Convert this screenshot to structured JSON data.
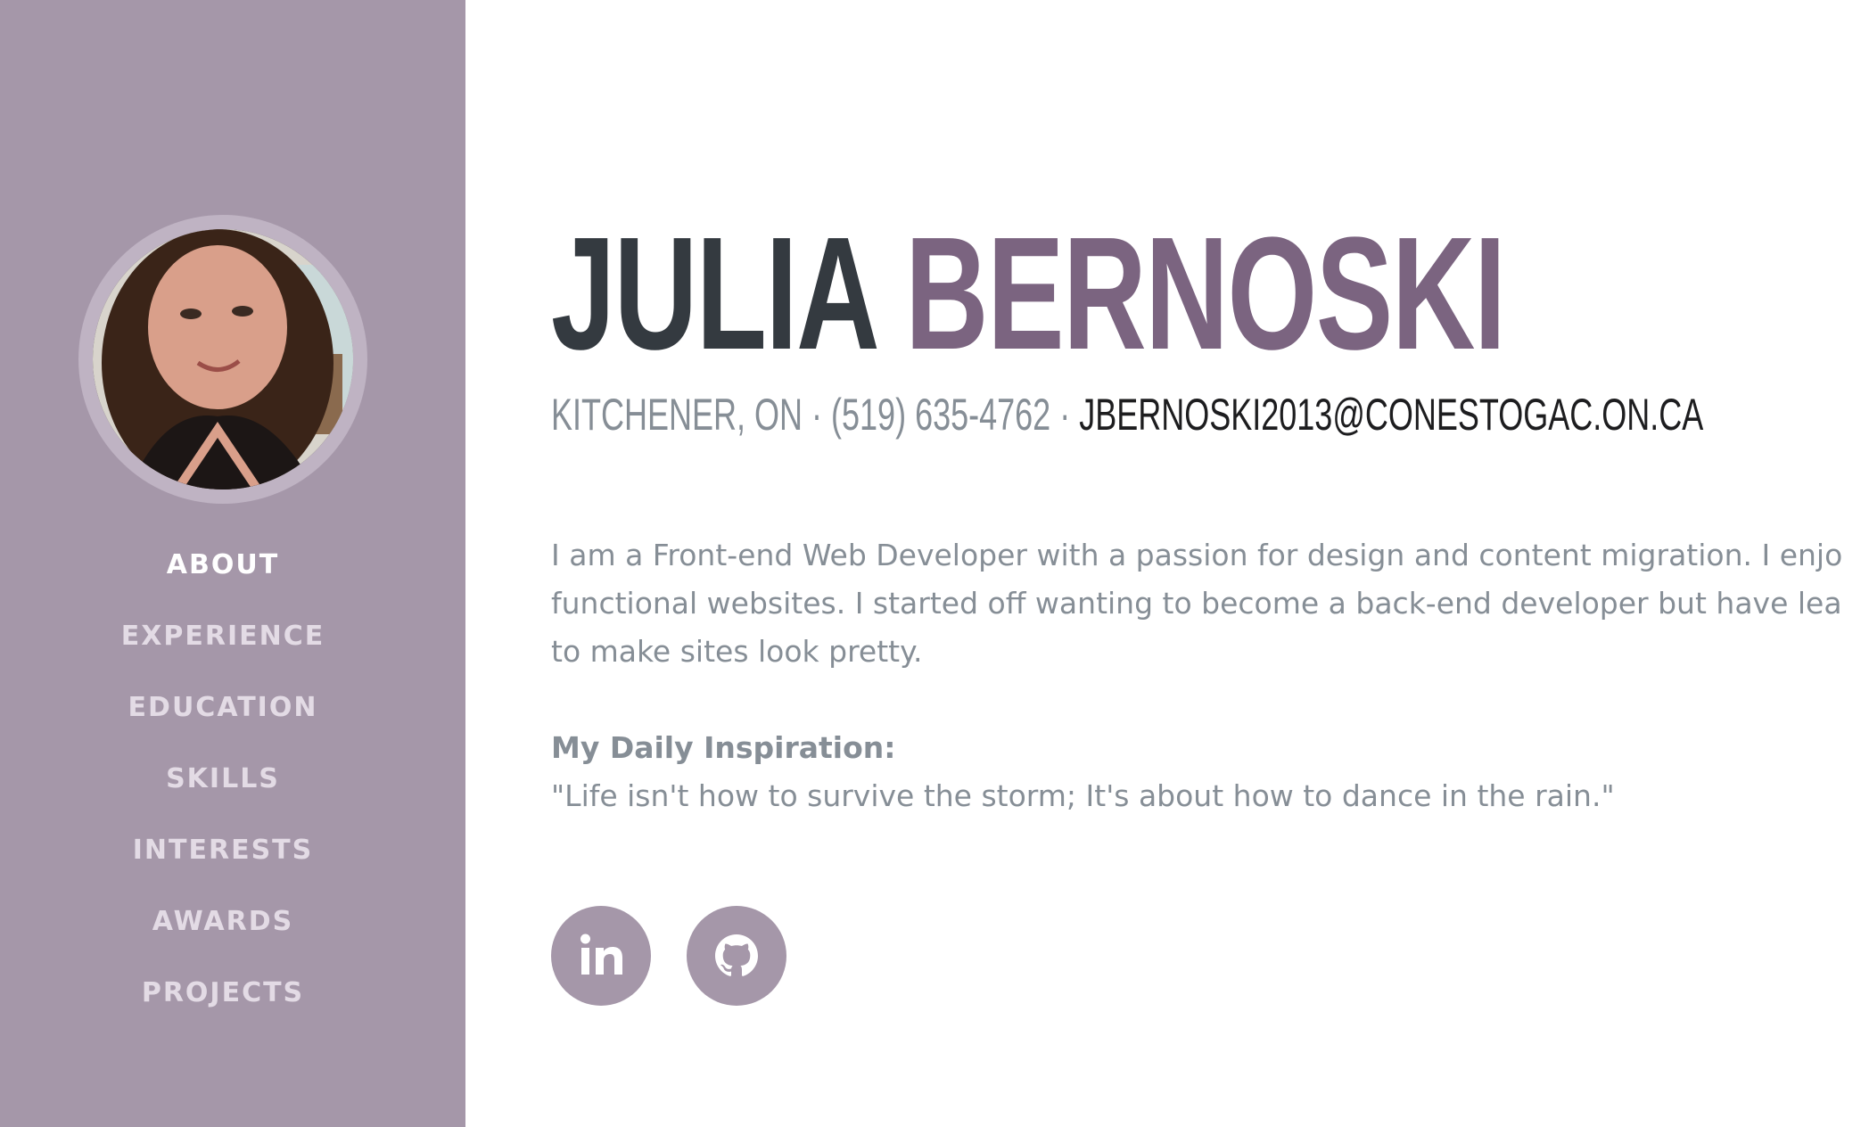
{
  "colors": {
    "sidebar": "#a597a9",
    "accent": "#7b6480",
    "name_dark": "#343a40",
    "muted_text": "#868e96"
  },
  "sidebar": {
    "nav": [
      {
        "label": "ABOUT",
        "active": true
      },
      {
        "label": "EXPERIENCE"
      },
      {
        "label": "EDUCATION"
      },
      {
        "label": "SKILLS"
      },
      {
        "label": "INTERESTS"
      },
      {
        "label": "AWARDS"
      },
      {
        "label": "PROJECTS"
      }
    ]
  },
  "about": {
    "first_name": "JULIA",
    "last_name": "BERNOSKI",
    "location": "KITCHENER, ON",
    "separator": " · ",
    "phone": "(519) 635-4762",
    "email": "JBERNOSKI2013@CONESTOGAC.ON.CA",
    "lead_line1": "I am a Front-end Web Developer with a passion for design and content migration. I enjo",
    "lead_line2": "functional websites. I started off wanting to become a back-end developer but have lea",
    "lead_line3": "to make sites look pretty.",
    "inspiration_label": "My Daily Inspiration:",
    "inspiration_quote": "\"Life isn't how to survive the storm; It's about how to dance in the rain.\""
  },
  "social": [
    {
      "icon": "linkedin-icon",
      "text": "in"
    },
    {
      "icon": "github-icon"
    }
  ]
}
